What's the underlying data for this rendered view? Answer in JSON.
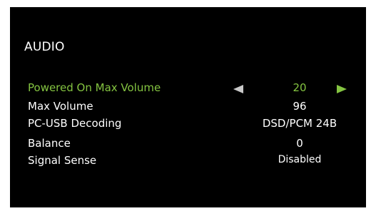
{
  "menu": {
    "title": "AUDIO",
    "items": [
      {
        "label": "Powered On Max Volume",
        "value": "20",
        "selected": true
      },
      {
        "label": "Max Volume",
        "value": "96",
        "selected": false
      },
      {
        "label": "PC-USB Decoding",
        "value": "DSD/PCM 24B",
        "selected": false
      },
      {
        "label": "Balance",
        "value": "0",
        "selected": false
      },
      {
        "label": "Signal Sense",
        "value": "Disabled",
        "selected": false
      }
    ]
  },
  "icons": {
    "left": "triangle-left-icon",
    "right": "triangle-right-icon"
  },
  "colors": {
    "background": "#000000",
    "text": "#ffffff",
    "accent": "#84c441",
    "arrow_inactive": "#c9c9c9",
    "frame": "#ffffff"
  }
}
